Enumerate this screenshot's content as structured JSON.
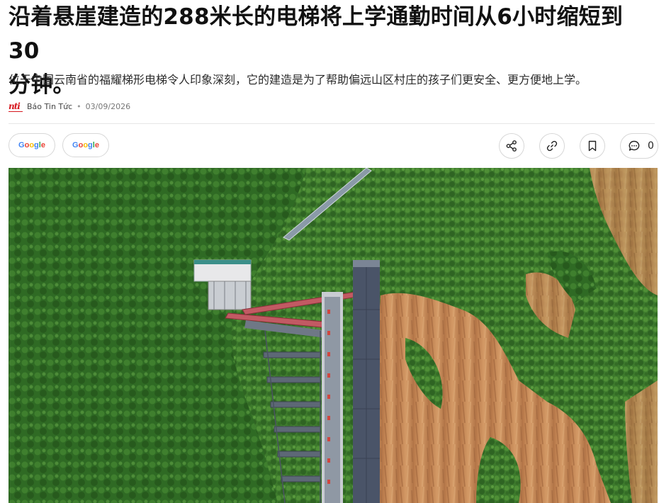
{
  "article": {
    "title_line1": "沿着悬崖建造的288米长的电梯将上学通勤时间从6小时缩短到30",
    "title_line2": "分钟。",
    "summary": "位于中国云南省的福耀梯形电梯令人印象深刻，它的建造是为了帮助偏远山区村庄的孩子们更安全、更方便地上学。",
    "source_logo": "nti",
    "source": "Báo Tin Tức",
    "separator": "•",
    "date": "03/09/2026"
  },
  "toolbar": {
    "google_buttons": [
      {
        "letters": [
          "G",
          "o",
          "o",
          "g",
          "l",
          "e"
        ]
      },
      {
        "letters": [
          "G",
          "o",
          "o",
          "g",
          "l",
          "e"
        ]
      }
    ],
    "share_icon": "share-icon",
    "link_icon": "link-icon",
    "bookmark_icon": "bookmark-icon",
    "comment_icon": "comment-icon",
    "comment_count": "0"
  },
  "image": {
    "subject": "cliffside-elevator-photo",
    "colors": {
      "forest": "#3f7a2e",
      "forest_dark": "#2a5a1e",
      "cliff": "#c98a55",
      "tower": "#4a5468",
      "deck": "#c04a55"
    }
  }
}
